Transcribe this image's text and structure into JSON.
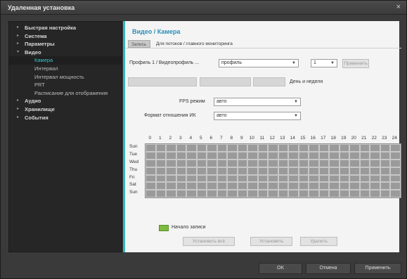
{
  "window": {
    "title": "Удаленная установка",
    "close_glyph": "×"
  },
  "sidebar": {
    "items": [
      {
        "label": "Быстрая настройка",
        "level": 0,
        "arrow": "▸"
      },
      {
        "label": "Система",
        "level": 0,
        "arrow": "▸"
      },
      {
        "label": "Параметры",
        "level": 0,
        "arrow": "▸"
      },
      {
        "label": "Видео",
        "level": 0,
        "arrow": "▾"
      },
      {
        "label": "Камера",
        "level": 1,
        "selected": true
      },
      {
        "label": "Интервал",
        "level": 1
      },
      {
        "label": "Интервал мощность",
        "level": 1
      },
      {
        "label": "PRT",
        "level": 1
      },
      {
        "label": "Расписание для отображения",
        "level": 1
      },
      {
        "label": "Аудио",
        "level": 0,
        "arrow": "▸"
      },
      {
        "label": "Хранилище",
        "level": 0,
        "arrow": "▸"
      },
      {
        "label": "События",
        "level": 0,
        "arrow": "▸"
      }
    ]
  },
  "panel": {
    "title": "Видео / Камера",
    "tabs": [
      {
        "label": "Запись",
        "active": true
      },
      {
        "label": "Для потоков / главного мониторинга",
        "active": false
      }
    ],
    "profile_label": "Профиль 1 / Видеопрофиль ...",
    "profile_select": "профиль",
    "small_select": "1",
    "apply_button": "Применить",
    "day_week_label": "День и неделя",
    "fps_label": "FPS режим",
    "fps_value": "авто",
    "bitrate_label": "Формат отношения ИК",
    "bitrate_value": "авто",
    "days": [
      "Sun",
      "Tue",
      "Wed",
      "Thu",
      "Fri",
      "Sat",
      "Sun"
    ],
    "hours": [
      "0",
      "1",
      "2",
      "3",
      "4",
      "5",
      "6",
      "7",
      "8",
      "9",
      "10",
      "11",
      "12",
      "13",
      "14",
      "15",
      "16",
      "17",
      "18",
      "19",
      "20",
      "21",
      "22",
      "23",
      "24"
    ],
    "legend_label": "Начало записи",
    "bottom_buttons": [
      "Установить всё",
      "Установить",
      "Удалить"
    ]
  },
  "footer": {
    "ok": "OK",
    "cancel": "Отмена",
    "apply": "Применить"
  },
  "colors": {
    "accent": "#2fb8c0",
    "legend": "#7dbb3f",
    "cell": "#9a9a9a"
  }
}
